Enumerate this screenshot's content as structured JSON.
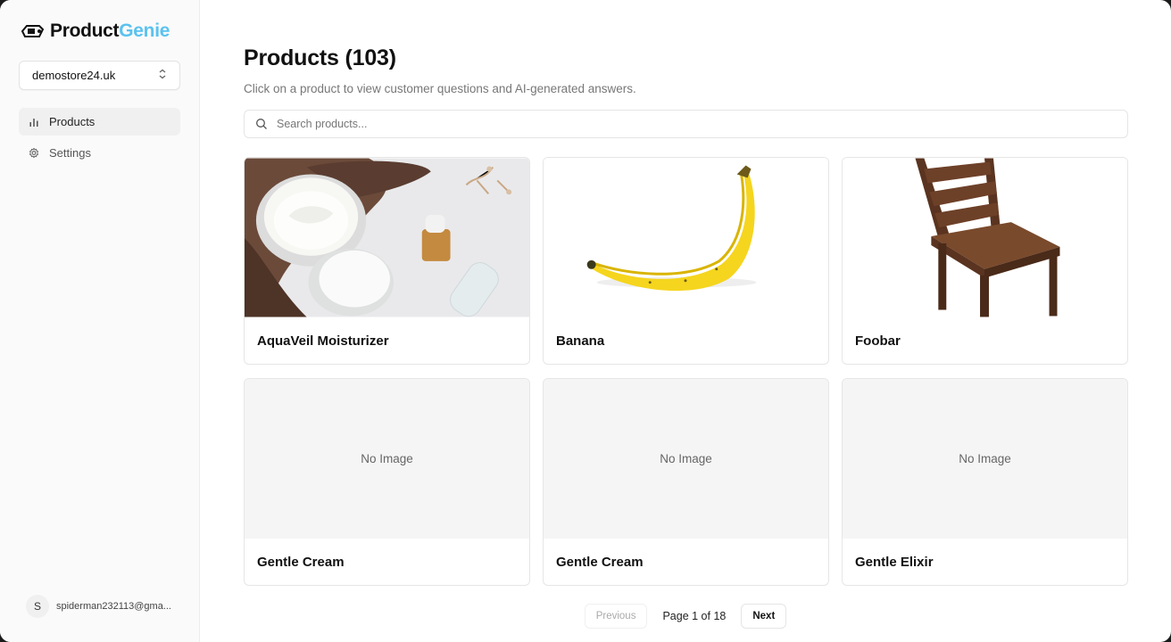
{
  "app": {
    "logo_part1": "Product",
    "logo_part2": "Genie",
    "brand_color": "#5bc2ef"
  },
  "sidebar": {
    "store": "demostore24.uk",
    "items": [
      {
        "label": "Products",
        "icon": "bar-chart-icon",
        "active": true
      },
      {
        "label": "Settings",
        "icon": "gear-icon",
        "active": false
      }
    ],
    "user": {
      "initial": "S",
      "email": "spiderman232113@gma..."
    }
  },
  "main": {
    "title": "Products (103)",
    "subtitle": "Click on a product to view customer questions and AI-generated answers.",
    "search_placeholder": "Search products...",
    "no_image_label": "No Image",
    "products": [
      {
        "name": "AquaVeil Moisturizer",
        "image": "skincare-photo"
      },
      {
        "name": "Banana",
        "image": "banana-photo"
      },
      {
        "name": "Foobar",
        "image": "chair-photo"
      },
      {
        "name": "Gentle Cream",
        "image": "none"
      },
      {
        "name": "Gentle Cream",
        "image": "none"
      },
      {
        "name": "Gentle Elixir",
        "image": "none"
      }
    ]
  },
  "pagination": {
    "previous": "Previous",
    "status": "Page 1 of 18",
    "next": "Next"
  }
}
